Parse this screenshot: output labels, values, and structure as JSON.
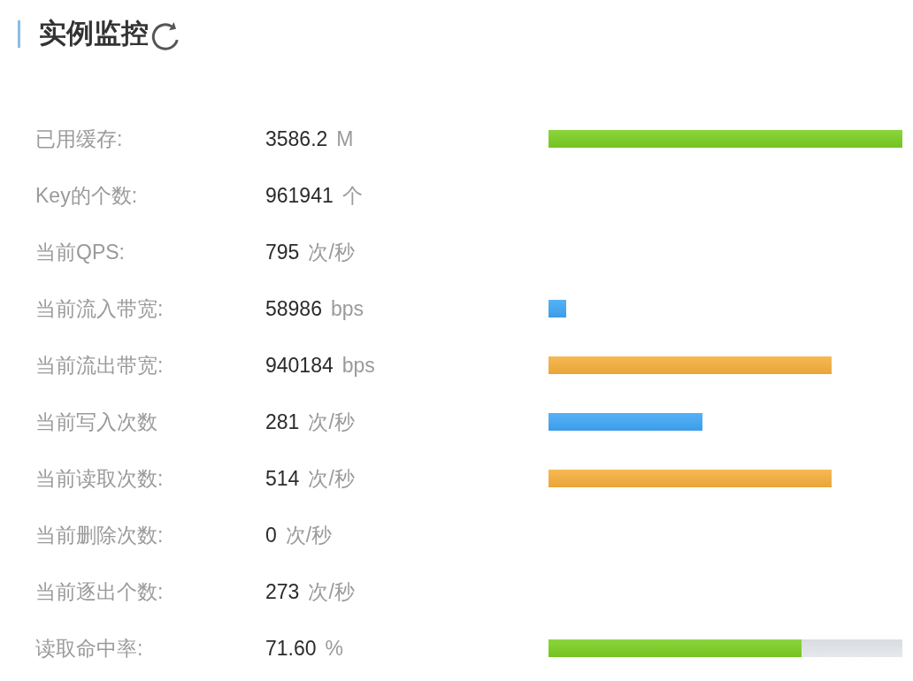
{
  "header": {
    "title": "实例监控"
  },
  "metrics": [
    {
      "label": "已用缓存:",
      "value": "3586.2",
      "unit": "M",
      "bar": {
        "level": 1,
        "color": "#7bcf22"
      }
    },
    {
      "label": "Key的个数:",
      "value": "961941",
      "unit": "个"
    },
    {
      "label": "当前QPS:",
      "value": "795",
      "unit": "次/秒"
    },
    {
      "label": "当前流入带宽:",
      "value": "58986",
      "unit": "bps",
      "bar": {
        "level": 0.05,
        "color": "#3fa7f6",
        "track_shown": false
      }
    },
    {
      "label": "当前流出带宽:",
      "value": "940184",
      "unit": "bps",
      "bar": {
        "level": 0.8,
        "color": "#f6af3c",
        "track_shown": false
      }
    },
    {
      "label": "当前写入次数",
      "value": "281",
      "unit": "次/秒",
      "bar": {
        "level": 0.435,
        "color": "#3fa7f6",
        "track_shown": false
      }
    },
    {
      "label": "当前读取次数:",
      "value": "514",
      "unit": "次/秒",
      "bar": {
        "level": 0.8,
        "color": "#f6af3c",
        "track_shown": false
      }
    },
    {
      "label": "当前删除次数:",
      "value": "0",
      "unit": "次/秒"
    },
    {
      "label": "当前逐出个数:",
      "value": "273",
      "unit": "次/秒"
    },
    {
      "label": "读取命中率:",
      "value": "71.60",
      "unit": "%",
      "bar": {
        "level": 0.716,
        "color": "#7bcf22",
        "track_shown": true
      }
    }
  ]
}
